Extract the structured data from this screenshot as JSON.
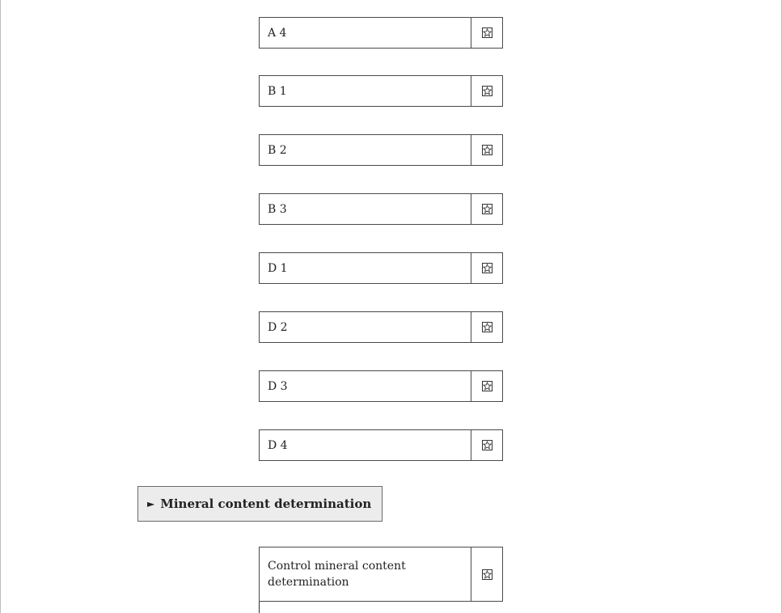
{
  "parameters": [
    {
      "label": "A 4",
      "icon": "star-icon"
    },
    {
      "label": "B 1",
      "icon": "star-icon"
    },
    {
      "label": "B 2",
      "icon": "star-icon"
    },
    {
      "label": "B 3",
      "icon": "star-icon"
    },
    {
      "label": "D 1",
      "icon": "star-icon"
    },
    {
      "label": "D 2",
      "icon": "star-icon"
    },
    {
      "label": "D 3",
      "icon": "star-icon"
    },
    {
      "label": "D 4",
      "icon": "star-icon"
    }
  ],
  "submenu": {
    "arrow": "►",
    "label": "Mineral content determination"
  },
  "control_parameter": {
    "label": "Control mineral content determination",
    "icon": "star-icon"
  }
}
